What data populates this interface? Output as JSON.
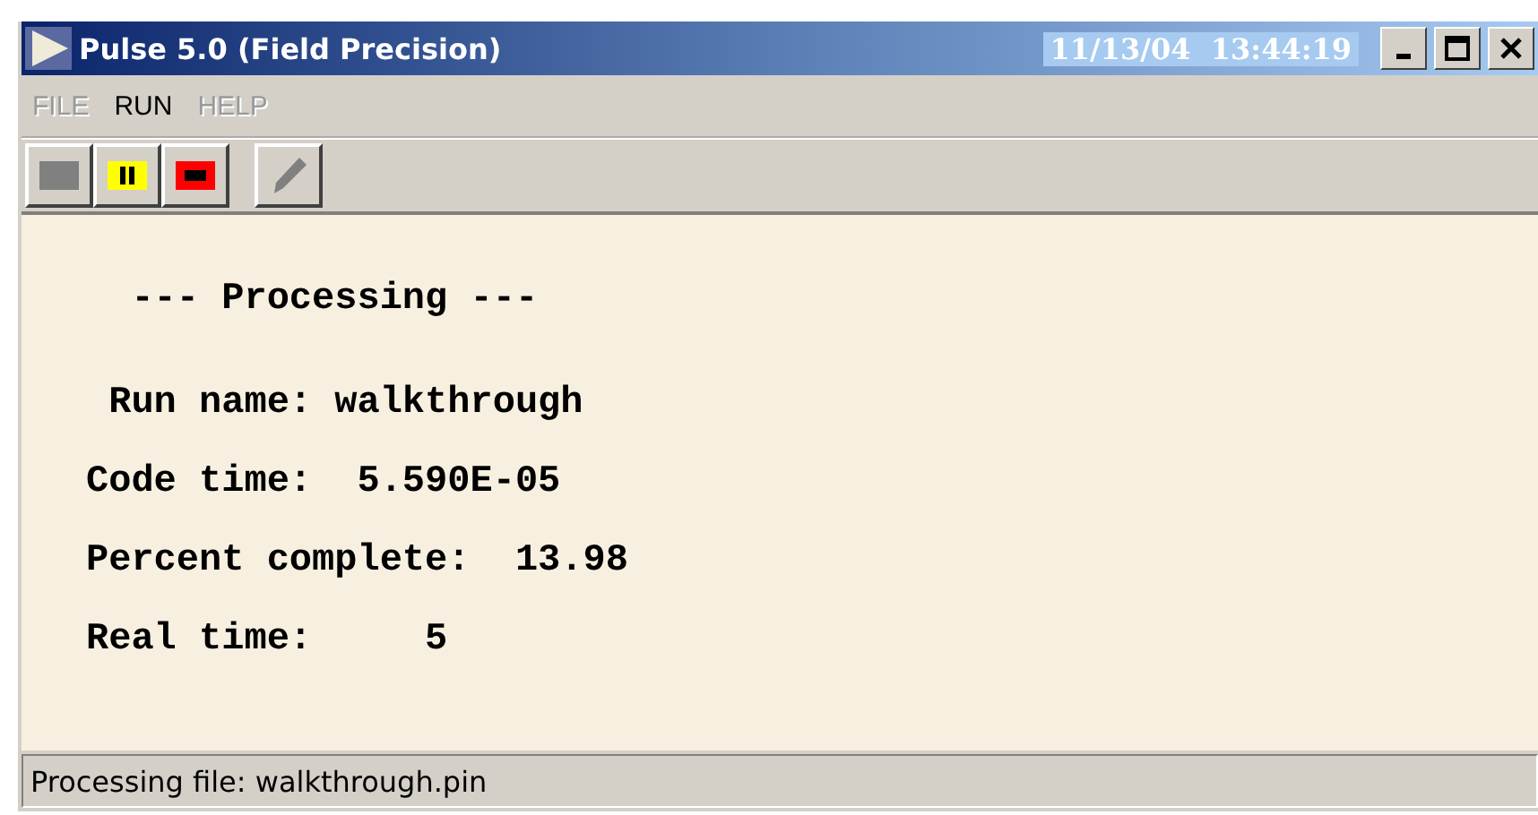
{
  "window": {
    "title": "Pulse 5.0 (Field Precision)",
    "clock": "11/13/04  13:44:19"
  },
  "menu": [
    {
      "label": "FILE",
      "disabled": true
    },
    {
      "label": "RUN",
      "disabled": false
    },
    {
      "label": "HELP",
      "disabled": true
    }
  ],
  "toolbar": [
    {
      "kind": "start",
      "disabled": true
    },
    {
      "kind": "pause",
      "disabled": false
    },
    {
      "kind": "stop",
      "disabled": false
    },
    {
      "kind": "edit",
      "disabled": true
    }
  ],
  "output": [
    "  --- Processing ---",
    " Run name: walkthrough",
    "Code time:  5.590E-05",
    "Percent complete:  13.98",
    "Real time:     5"
  ],
  "status_bar": "Processing file: walkthrough.pin"
}
